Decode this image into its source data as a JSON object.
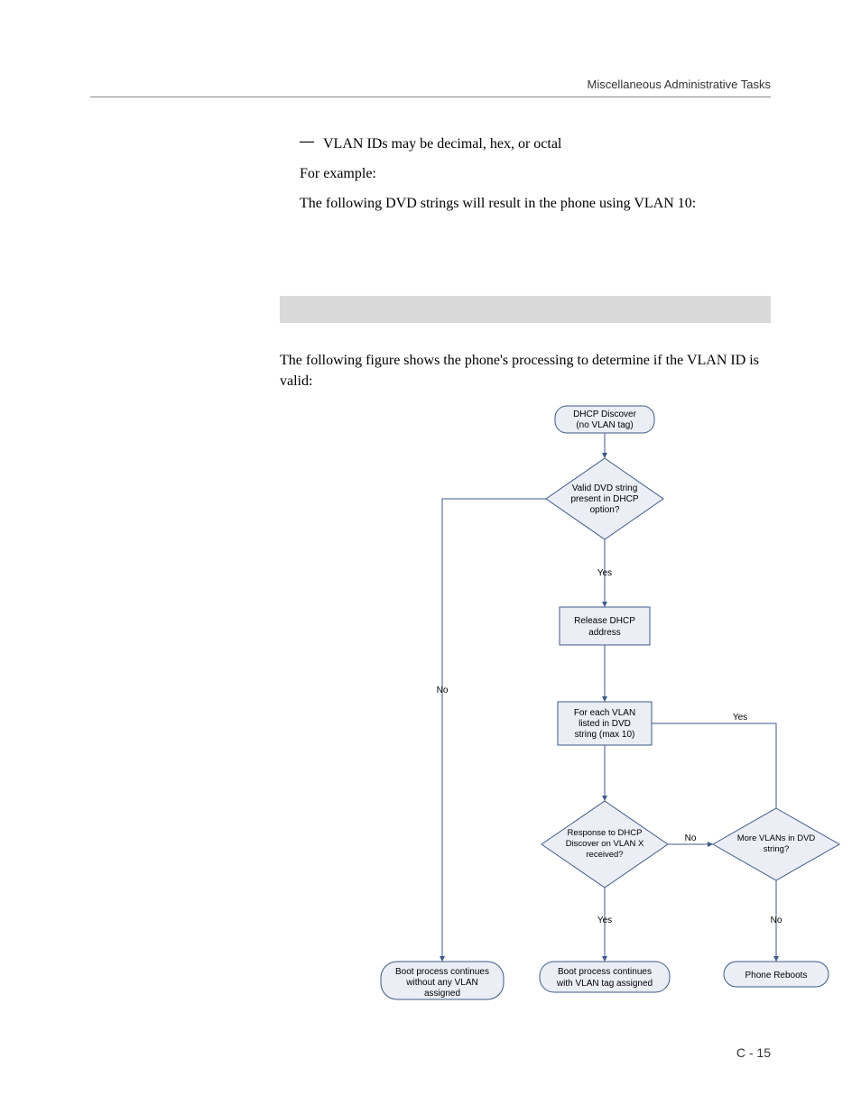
{
  "header": {
    "running_title": "Miscellaneous Administrative Tasks"
  },
  "content": {
    "bullet1": "VLAN IDs may be decimal, hex, or octal",
    "para_forexample": "For example:",
    "para_dvd": "The following DVD strings will result in the phone using VLAN 10:",
    "fig_caption": "The following figure shows the phone's processing to determine if the VLAN ID is valid:"
  },
  "chart_data": {
    "type": "flowchart",
    "nodes": [
      {
        "id": "n1",
        "shape": "terminator",
        "text": "DHCP Discover (no VLAN tag)"
      },
      {
        "id": "n2",
        "shape": "decision",
        "text": "Valid DVD string present in DHCP option?"
      },
      {
        "id": "n3",
        "shape": "process",
        "text": "Release DHCP address"
      },
      {
        "id": "n4",
        "shape": "process",
        "text": "For each VLAN listed in DVD string (max 10)"
      },
      {
        "id": "n5",
        "shape": "decision",
        "text": "Response to DHCP Discover on VLAN X received?"
      },
      {
        "id": "n6",
        "shape": "decision",
        "text": "More VLANs in DVD string?"
      },
      {
        "id": "n7",
        "shape": "terminator",
        "text": "Boot process continues without any VLAN assigned"
      },
      {
        "id": "n8",
        "shape": "terminator",
        "text": "Boot process continues with VLAN tag assigned"
      },
      {
        "id": "n9",
        "shape": "terminator",
        "text": "Phone Reboots"
      }
    ],
    "edges": [
      {
        "from": "n1",
        "to": "n2",
        "label": ""
      },
      {
        "from": "n2",
        "to": "n3",
        "label": "Yes"
      },
      {
        "from": "n2",
        "to": "n7",
        "label": "No"
      },
      {
        "from": "n3",
        "to": "n4",
        "label": ""
      },
      {
        "from": "n4",
        "to": "n5",
        "label": ""
      },
      {
        "from": "n5",
        "to": "n8",
        "label": "Yes"
      },
      {
        "from": "n5",
        "to": "n6",
        "label": "No"
      },
      {
        "from": "n6",
        "to": "n4",
        "label": "Yes"
      },
      {
        "from": "n6",
        "to": "n9",
        "label": "No"
      }
    ]
  },
  "flow": {
    "n1a": "DHCP Discover",
    "n1b": "(no VLAN tag)",
    "n2a": "Valid DVD string",
    "n2b": "present in DHCP",
    "n2c": "option?",
    "n3a": "Release DHCP",
    "n3b": "address",
    "n4a": "For each VLAN",
    "n4b": "listed in DVD",
    "n4c": "string (max 10)",
    "n5a": "Response to DHCP",
    "n5b": "Discover on VLAN X",
    "n5c": "received?",
    "n6a": "More VLANs in DVD",
    "n6b": "string?",
    "n7a": "Boot process continues",
    "n7b": "without any VLAN",
    "n7c": "assigned",
    "n8a": "Boot process continues",
    "n8b": "with VLAN tag assigned",
    "n9a": "Phone Reboots",
    "lblYes": "Yes",
    "lblNo": "No"
  },
  "footer": {
    "pagenum": "C - 15"
  }
}
